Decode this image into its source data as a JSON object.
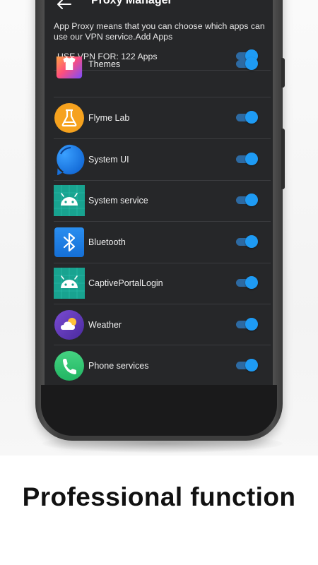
{
  "header": {
    "title": "Proxy Manager"
  },
  "description": "App Proxy means that you can choose which apps can use our VPN service.Add Apps",
  "vpn_summary": {
    "label": "USE VPN FOR: 122 Apps",
    "enabled": true
  },
  "apps": [
    {
      "name": "Themes",
      "icon": "themes-icon",
      "enabled": true
    },
    {
      "name": "Flyme Lab",
      "icon": "flyme-lab-icon",
      "enabled": true
    },
    {
      "name": "System UI",
      "icon": "system-ui-icon",
      "enabled": true
    },
    {
      "name": "System service",
      "icon": "android-icon",
      "enabled": true
    },
    {
      "name": "Bluetooth",
      "icon": "bluetooth-icon",
      "enabled": true
    },
    {
      "name": "CaptivePortalLogin",
      "icon": "android-icon",
      "enabled": true
    },
    {
      "name": "Weather",
      "icon": "weather-icon",
      "enabled": true
    },
    {
      "name": "Phone services",
      "icon": "phone-icon",
      "enabled": true
    }
  ],
  "caption": "Professional function",
  "colors": {
    "screen_bg": "#262729",
    "toggle_accent": "#1e9bf4",
    "caption_text": "#111111"
  }
}
